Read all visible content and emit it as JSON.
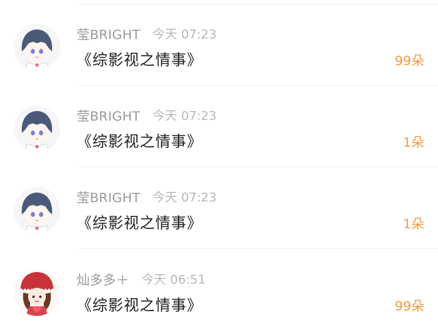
{
  "rows": [
    {
      "name": "莹BRIGHT",
      "time": "今天 07:23",
      "title": "《综影视之情事》",
      "count": "99朵",
      "avatar": "girl-blue-hair-avatar"
    },
    {
      "name": "莹BRIGHT",
      "time": "今天 07:23",
      "title": "《综影视之情事》",
      "count": "1朵",
      "avatar": "girl-blue-hair-avatar"
    },
    {
      "name": "莹BRIGHT",
      "time": "今天 07:23",
      "title": "《综影视之情事》",
      "count": "1朵",
      "avatar": "girl-blue-hair-avatar"
    },
    {
      "name": "灿多多＋",
      "time": "今天 06:51",
      "title": "《综影视之情事》",
      "count": "99朵",
      "avatar": "girl-red-hat-avatar"
    }
  ],
  "colors": {
    "count": "#f49a3e",
    "name": "#9a9a9a",
    "time": "#b7b7b7",
    "title": "#222222"
  }
}
